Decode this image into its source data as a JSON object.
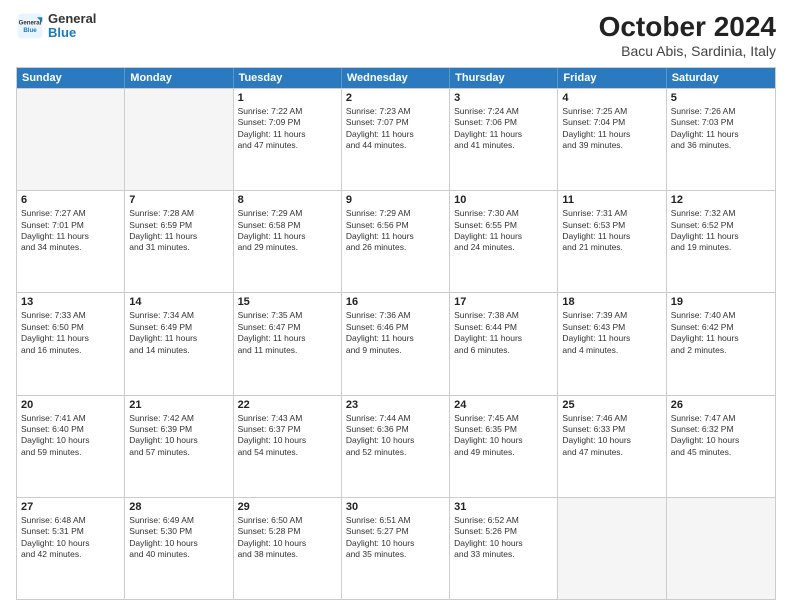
{
  "header": {
    "logo": {
      "line1": "General",
      "line2": "Blue"
    },
    "title": "October 2024",
    "subtitle": "Bacu Abis, Sardinia, Italy"
  },
  "weekdays": [
    "Sunday",
    "Monday",
    "Tuesday",
    "Wednesday",
    "Thursday",
    "Friday",
    "Saturday"
  ],
  "weeks": [
    [
      {
        "day": "",
        "empty": true,
        "lines": []
      },
      {
        "day": "",
        "empty": true,
        "lines": []
      },
      {
        "day": "1",
        "lines": [
          "Sunrise: 7:22 AM",
          "Sunset: 7:09 PM",
          "Daylight: 11 hours",
          "and 47 minutes."
        ]
      },
      {
        "day": "2",
        "lines": [
          "Sunrise: 7:23 AM",
          "Sunset: 7:07 PM",
          "Daylight: 11 hours",
          "and 44 minutes."
        ]
      },
      {
        "day": "3",
        "lines": [
          "Sunrise: 7:24 AM",
          "Sunset: 7:06 PM",
          "Daylight: 11 hours",
          "and 41 minutes."
        ]
      },
      {
        "day": "4",
        "lines": [
          "Sunrise: 7:25 AM",
          "Sunset: 7:04 PM",
          "Daylight: 11 hours",
          "and 39 minutes."
        ]
      },
      {
        "day": "5",
        "lines": [
          "Sunrise: 7:26 AM",
          "Sunset: 7:03 PM",
          "Daylight: 11 hours",
          "and 36 minutes."
        ]
      }
    ],
    [
      {
        "day": "6",
        "lines": [
          "Sunrise: 7:27 AM",
          "Sunset: 7:01 PM",
          "Daylight: 11 hours",
          "and 34 minutes."
        ]
      },
      {
        "day": "7",
        "lines": [
          "Sunrise: 7:28 AM",
          "Sunset: 6:59 PM",
          "Daylight: 11 hours",
          "and 31 minutes."
        ]
      },
      {
        "day": "8",
        "lines": [
          "Sunrise: 7:29 AM",
          "Sunset: 6:58 PM",
          "Daylight: 11 hours",
          "and 29 minutes."
        ]
      },
      {
        "day": "9",
        "lines": [
          "Sunrise: 7:29 AM",
          "Sunset: 6:56 PM",
          "Daylight: 11 hours",
          "and 26 minutes."
        ]
      },
      {
        "day": "10",
        "lines": [
          "Sunrise: 7:30 AM",
          "Sunset: 6:55 PM",
          "Daylight: 11 hours",
          "and 24 minutes."
        ]
      },
      {
        "day": "11",
        "lines": [
          "Sunrise: 7:31 AM",
          "Sunset: 6:53 PM",
          "Daylight: 11 hours",
          "and 21 minutes."
        ]
      },
      {
        "day": "12",
        "lines": [
          "Sunrise: 7:32 AM",
          "Sunset: 6:52 PM",
          "Daylight: 11 hours",
          "and 19 minutes."
        ]
      }
    ],
    [
      {
        "day": "13",
        "lines": [
          "Sunrise: 7:33 AM",
          "Sunset: 6:50 PM",
          "Daylight: 11 hours",
          "and 16 minutes."
        ]
      },
      {
        "day": "14",
        "lines": [
          "Sunrise: 7:34 AM",
          "Sunset: 6:49 PM",
          "Daylight: 11 hours",
          "and 14 minutes."
        ]
      },
      {
        "day": "15",
        "lines": [
          "Sunrise: 7:35 AM",
          "Sunset: 6:47 PM",
          "Daylight: 11 hours",
          "and 11 minutes."
        ]
      },
      {
        "day": "16",
        "lines": [
          "Sunrise: 7:36 AM",
          "Sunset: 6:46 PM",
          "Daylight: 11 hours",
          "and 9 minutes."
        ]
      },
      {
        "day": "17",
        "lines": [
          "Sunrise: 7:38 AM",
          "Sunset: 6:44 PM",
          "Daylight: 11 hours",
          "and 6 minutes."
        ]
      },
      {
        "day": "18",
        "lines": [
          "Sunrise: 7:39 AM",
          "Sunset: 6:43 PM",
          "Daylight: 11 hours",
          "and 4 minutes."
        ]
      },
      {
        "day": "19",
        "lines": [
          "Sunrise: 7:40 AM",
          "Sunset: 6:42 PM",
          "Daylight: 11 hours",
          "and 2 minutes."
        ]
      }
    ],
    [
      {
        "day": "20",
        "lines": [
          "Sunrise: 7:41 AM",
          "Sunset: 6:40 PM",
          "Daylight: 10 hours",
          "and 59 minutes."
        ]
      },
      {
        "day": "21",
        "lines": [
          "Sunrise: 7:42 AM",
          "Sunset: 6:39 PM",
          "Daylight: 10 hours",
          "and 57 minutes."
        ]
      },
      {
        "day": "22",
        "lines": [
          "Sunrise: 7:43 AM",
          "Sunset: 6:37 PM",
          "Daylight: 10 hours",
          "and 54 minutes."
        ]
      },
      {
        "day": "23",
        "lines": [
          "Sunrise: 7:44 AM",
          "Sunset: 6:36 PM",
          "Daylight: 10 hours",
          "and 52 minutes."
        ]
      },
      {
        "day": "24",
        "lines": [
          "Sunrise: 7:45 AM",
          "Sunset: 6:35 PM",
          "Daylight: 10 hours",
          "and 49 minutes."
        ]
      },
      {
        "day": "25",
        "lines": [
          "Sunrise: 7:46 AM",
          "Sunset: 6:33 PM",
          "Daylight: 10 hours",
          "and 47 minutes."
        ]
      },
      {
        "day": "26",
        "lines": [
          "Sunrise: 7:47 AM",
          "Sunset: 6:32 PM",
          "Daylight: 10 hours",
          "and 45 minutes."
        ]
      }
    ],
    [
      {
        "day": "27",
        "lines": [
          "Sunrise: 6:48 AM",
          "Sunset: 5:31 PM",
          "Daylight: 10 hours",
          "and 42 minutes."
        ]
      },
      {
        "day": "28",
        "lines": [
          "Sunrise: 6:49 AM",
          "Sunset: 5:30 PM",
          "Daylight: 10 hours",
          "and 40 minutes."
        ]
      },
      {
        "day": "29",
        "lines": [
          "Sunrise: 6:50 AM",
          "Sunset: 5:28 PM",
          "Daylight: 10 hours",
          "and 38 minutes."
        ]
      },
      {
        "day": "30",
        "lines": [
          "Sunrise: 6:51 AM",
          "Sunset: 5:27 PM",
          "Daylight: 10 hours",
          "and 35 minutes."
        ]
      },
      {
        "day": "31",
        "lines": [
          "Sunrise: 6:52 AM",
          "Sunset: 5:26 PM",
          "Daylight: 10 hours",
          "and 33 minutes."
        ]
      },
      {
        "day": "",
        "empty": true,
        "lines": []
      },
      {
        "day": "",
        "empty": true,
        "lines": []
      }
    ]
  ]
}
